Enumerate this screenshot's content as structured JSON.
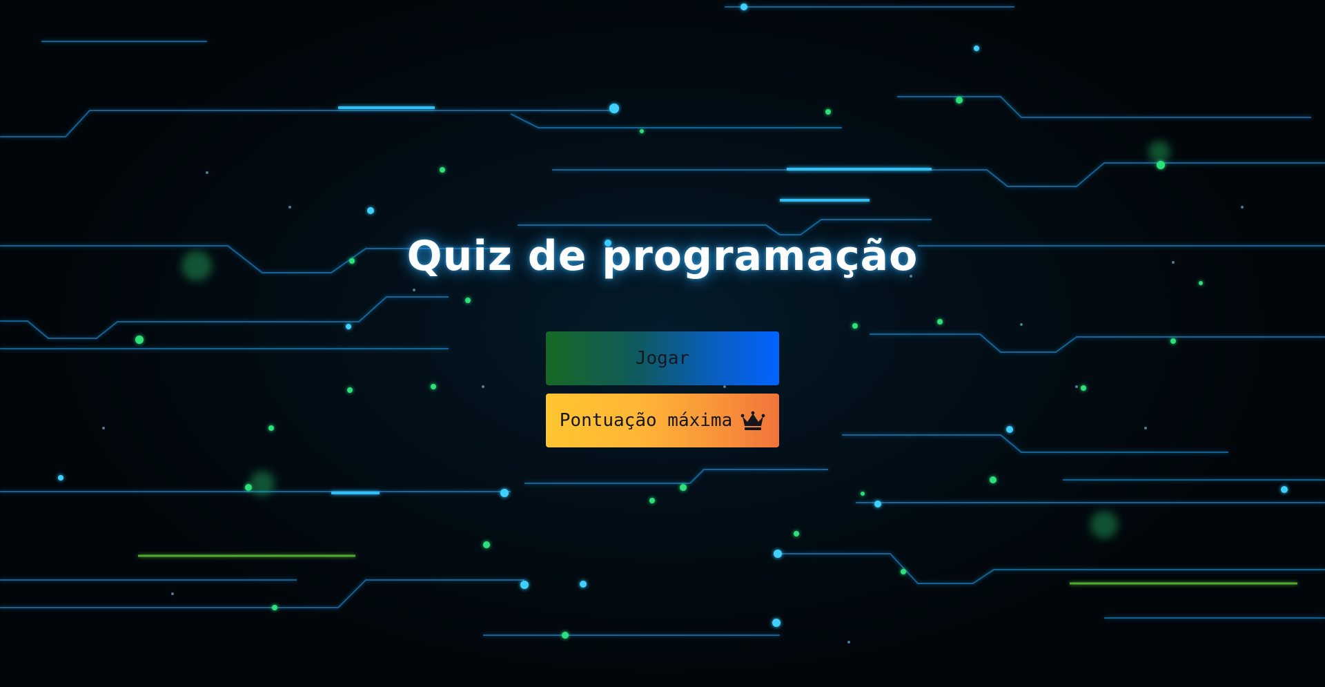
{
  "title": "Quiz de programação",
  "buttons": {
    "play_label": "Jogar",
    "high_score_label": "Pontuação máxima",
    "high_score_icon": "crown-icon"
  },
  "colors": {
    "background": "#02070c",
    "circuit_line": "#1e9bea",
    "circuit_glow": "#37c8ff",
    "particle_green": "#2fe07a",
    "play_gradient": [
      "#176a25",
      "#0064ff"
    ],
    "high_score_gradient": [
      "#ffc531",
      "#f0743a"
    ],
    "title_text": "#ffffff",
    "button_text": "#16161d"
  }
}
